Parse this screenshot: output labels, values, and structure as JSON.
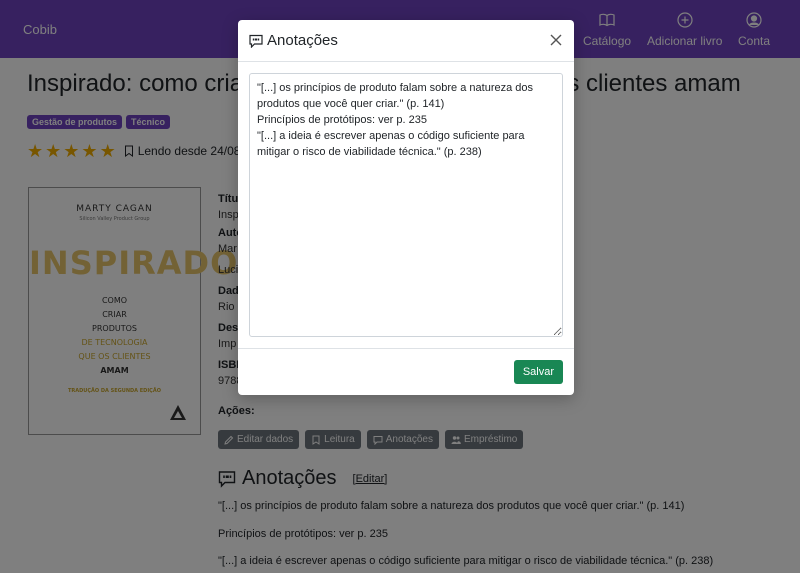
{
  "navbar": {
    "brand": "Cobib",
    "items": [
      {
        "label": "Catálogo",
        "icon": "book-icon"
      },
      {
        "label": "Adicionar livro",
        "icon": "plus-circle-icon"
      },
      {
        "label": "Conta",
        "icon": "user-circle-icon"
      }
    ]
  },
  "book": {
    "title": "Inspirado: como criar produtos de tecnologia que os clientes amam",
    "tags": [
      "Gestão de produtos",
      "Técnico"
    ],
    "rating": 5,
    "reading_since": "Lendo desde 24/08/20",
    "cover": {
      "author": "MARTY CAGAN",
      "author_sub": "Silicon Valley Product Group",
      "big_title": "INSPIRADO",
      "lines": [
        "COMO",
        "CRIAR",
        "PRODUTOS",
        "DE TECNOLOGIA",
        "QUE OS CLIENTES",
        "AMAM"
      ],
      "translation": "TRADUÇÃO DA SEGUNDA EDIÇÃO"
    },
    "details": [
      {
        "label": "Títu",
        "value": "Insp"
      },
      {
        "label": "Auto",
        "value": "Mar"
      },
      {
        "label": "",
        "value": "Luci"
      },
      {
        "label": "Dad",
        "value": "Rio d"
      },
      {
        "label": "Desc",
        "value": "Imp"
      },
      {
        "label": "ISBN",
        "value": "9788"
      }
    ]
  },
  "actions": {
    "label": "Ações:",
    "buttons": [
      "Editar dados",
      "Leitura",
      "Anotações",
      "Empréstimo"
    ]
  },
  "notes_section": {
    "title": "Anotações",
    "edit_label": "[Editar]",
    "lines": [
      "\"[...] os princípios de produto falam sobre a natureza dos produtos que você quer criar.\" (p. 141)",
      "Princípios de protótipos: ver p. 235",
      "\"[...] a ideia é escrever apenas o código suficiente para mitigar o risco de viabilidade técnica.\" (p. 238)"
    ]
  },
  "modal": {
    "title": "Anotações",
    "textarea_value": "\"[...] os princípios de produto falam sobre a natureza dos produtos que você quer criar.\" (p. 141)\nPrincípios de protótipos: ver p. 235\n\"[...] a ideia é escrever apenas o código suficiente para mitigar o risco de viabilidade técnica.\" (p. 238)",
    "save_label": "Salvar"
  },
  "colors": {
    "navbar": "#6f42c1",
    "tag": "#6f42c1",
    "save_button": "#198754",
    "action_button": "#6c757d",
    "star": "#f0ad00"
  }
}
